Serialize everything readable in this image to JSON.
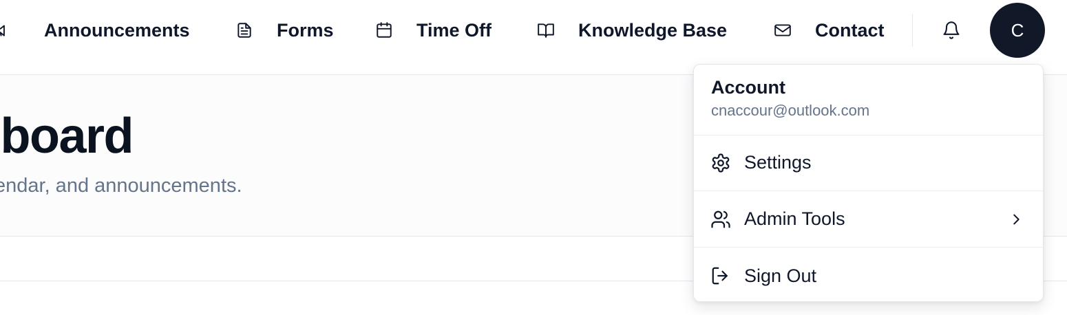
{
  "nav": {
    "items": [
      {
        "label": "Announcements",
        "icon": "megaphone-icon"
      },
      {
        "label": "Forms",
        "icon": "file-text-icon"
      },
      {
        "label": "Time Off",
        "icon": "calendar-icon"
      },
      {
        "label": "Knowledge Base",
        "icon": "book-open-icon"
      },
      {
        "label": "Contact",
        "icon": "mail-icon"
      }
    ],
    "notifications_icon": "bell-icon",
    "avatar_initial": "C"
  },
  "main": {
    "title": "hboard",
    "subtitle": "endar, and announcements."
  },
  "account_menu": {
    "title": "Account",
    "email": "cnaccour@outlook.com",
    "items": [
      {
        "label": "Settings",
        "icon": "gear-icon"
      },
      {
        "label": "Admin Tools",
        "icon": "users-icon",
        "submenu_icon": "chevron-right-icon"
      },
      {
        "label": "Sign Out",
        "icon": "log-out-icon"
      }
    ]
  },
  "colors": {
    "text": "#0f172a",
    "muted": "#64748b",
    "border": "#e5e7eb",
    "avatar_bg": "#111827"
  }
}
